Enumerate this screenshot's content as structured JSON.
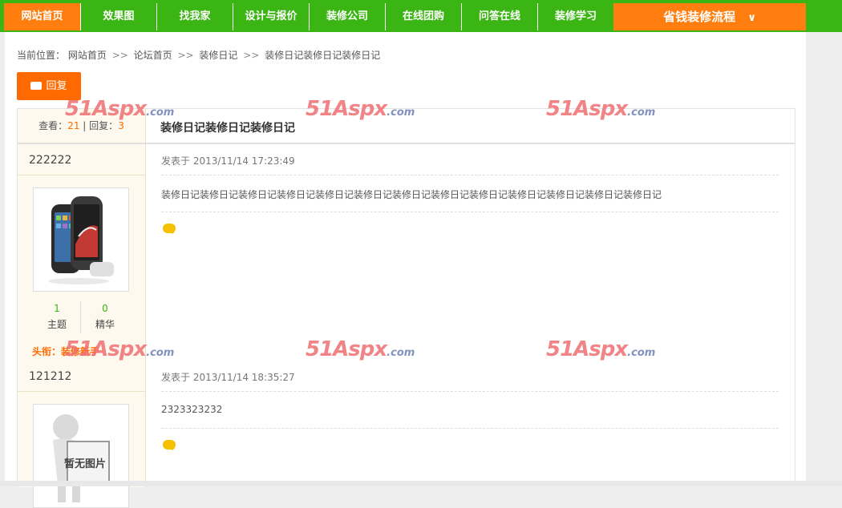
{
  "nav": {
    "items": [
      {
        "label": "网站首页"
      },
      {
        "label": "效果图"
      },
      {
        "label": "找我家"
      },
      {
        "label": "设计与报价"
      },
      {
        "label": "装修公司"
      },
      {
        "label": "在线团购"
      },
      {
        "label": "问答在线"
      },
      {
        "label": "装修学习"
      }
    ],
    "process_label": "省钱装修流程",
    "process_chevron": "V"
  },
  "breadcrumb": {
    "prefix": "当前位置：",
    "items": [
      "网站首页",
      "论坛首页",
      "装修日记",
      "装修日记装修日记装修日记"
    ],
    "separator": ">>"
  },
  "reply_button": {
    "label": "回复",
    "icon": "comment-icon"
  },
  "thread": {
    "views_label": "查看：",
    "views": "21",
    "divider": "|",
    "replies_label": "回复：",
    "replies": "3",
    "title": "装修日记装修日记装修日记"
  },
  "posts": [
    {
      "author": "222222",
      "posted": "发表于 2013/11/14 17:23:49",
      "content": "装修日记装修日记装修日记装修日记装修日记装修日记装修日记装修日记装修日记装修日记装修日记装修日记装修日记",
      "topics_value": "1",
      "topics_label": "主题",
      "digest_value": "0",
      "digest_label": "精华",
      "rank": "头衔：装修新手"
    },
    {
      "author": "121212",
      "posted": "发表于 2013/11/14 18:35:27",
      "content": "2323323232",
      "no_image_text": "暂无图片"
    }
  ],
  "watermark": {
    "big": "51Aspx",
    "dot": ".com"
  },
  "colors": {
    "nav_green": "#3bb513",
    "accent_orange": "#ff7e0f",
    "reply_orange": "#ff6a00"
  }
}
